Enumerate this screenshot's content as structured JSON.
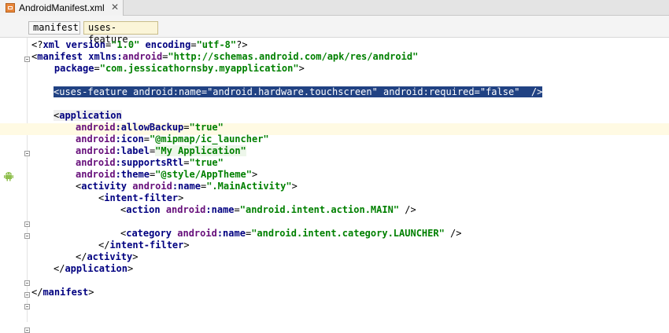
{
  "tab": {
    "file_name": "AndroidManifest.xml",
    "close_glyph": "✕"
  },
  "breadcrumb": {
    "items": [
      "manifest",
      "uses-feature"
    ]
  },
  "code": {
    "l1": {
      "a": "<?",
      "b": "xml",
      "c": " version",
      "d": "=",
      "e": "\"1.0\"",
      "f": " encoding",
      "g": "=",
      "h": "\"utf-8\"",
      "i": "?>"
    },
    "l2": {
      "a": "<",
      "b": "manifest",
      "c": " xmlns:",
      "d": "android",
      "e": "=",
      "f": "\"http://schemas.android.com/apk/res/android\""
    },
    "l3": {
      "a": "    package",
      "b": "=",
      "c": "\"com.jessicathornsby.myapplication\"",
      "d": ">"
    },
    "l5": {
      "text": "<uses-feature android:name=\"android.hardware.touchscreen\" android:required=\"false\"  />"
    },
    "l7": {
      "a": "<",
      "b": "application"
    },
    "l8": {
      "ns": "android",
      "attr": ":allowBackup",
      "eq": "=",
      "val": "\"true\""
    },
    "l9": {
      "ns": "android",
      "attr": ":icon",
      "eq": "=",
      "val": "\"@mipmap/ic_launcher\""
    },
    "l10": {
      "ns": "android",
      "attr": ":label",
      "eq": "=",
      "val": "\"My Application\""
    },
    "l11": {
      "ns": "android",
      "attr": ":supportsRtl",
      "eq": "=",
      "val": "\"true\""
    },
    "l12": {
      "ns": "android",
      "attr": ":theme",
      "eq": "=",
      "val": "\"@style/AppTheme\"",
      "end": ">"
    },
    "l13": {
      "a": "<",
      "b": "activity",
      "ns": " android",
      "attr": ":name",
      "eq": "=",
      "val": "\".MainActivity\"",
      "end": ">"
    },
    "l14": {
      "a": "<",
      "b": "intent-filter",
      "end": ">"
    },
    "l15": {
      "a": "<",
      "b": "action",
      "ns": " android",
      "attr": ":name",
      "eq": "=",
      "val": "\"android.intent.action.MAIN\"",
      "end": " />"
    },
    "l17": {
      "a": "<",
      "b": "category",
      "ns": " android",
      "attr": ":name",
      "eq": "=",
      "val": "\"android.intent.category.LAUNCHER\"",
      "end": " />"
    },
    "l18": {
      "a": "</",
      "b": "intent-filter",
      "end": ">"
    },
    "l19": {
      "a": "</",
      "b": "activity",
      "end": ">"
    },
    "l20": {
      "a": "</",
      "b": "application",
      "end": ">"
    },
    "l22": {
      "a": "</",
      "b": "manifest",
      "end": ">"
    }
  },
  "icons": {
    "tab": "xml-file-icon",
    "gutter": "android-icon",
    "fold": "fold-marker-icon"
  },
  "colors": {
    "tag": "#000080",
    "namespace": "#660e7a",
    "value": "#008000",
    "selection": "#214283",
    "current_line": "#fffae3"
  }
}
